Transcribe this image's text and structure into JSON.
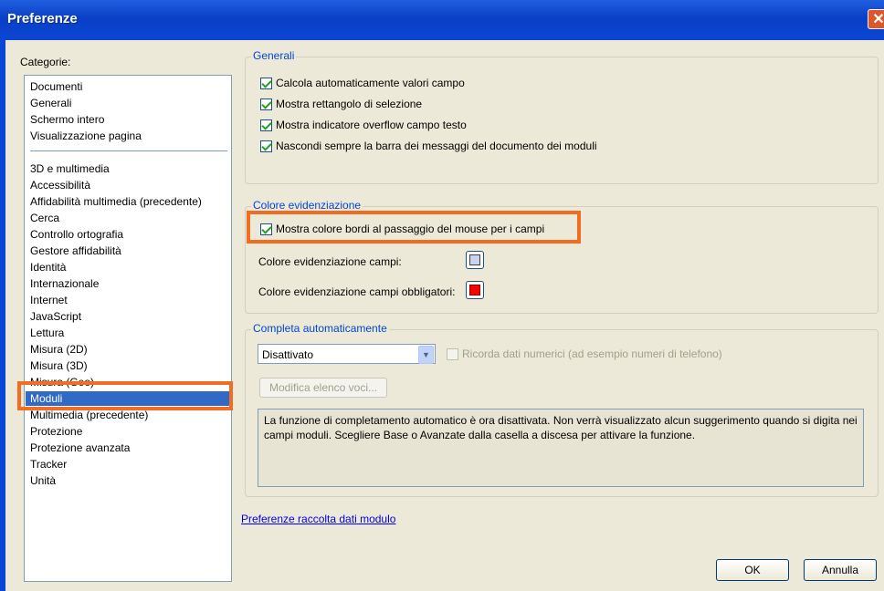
{
  "window": {
    "title": "Preferenze",
    "close_glyph": "✕"
  },
  "categories": {
    "label": "Categorie:",
    "group1": [
      "Documenti",
      "Generali",
      "Schermo intero",
      "Visualizzazione pagina"
    ],
    "group2": [
      "3D e multimedia",
      "Accessibilità",
      "Affidabilità multimedia (precedente)",
      "Cerca",
      "Controllo ortografia",
      "Gestore affidabilità",
      "Identità",
      "Internazionale",
      "Internet",
      "JavaScript",
      "Lettura",
      "Misura (2D)",
      "Misura (3D)",
      "Misura (Geo)",
      "Moduli",
      "Multimedia (precedente)",
      "Protezione",
      "Protezione avanzata",
      "Tracker",
      "Unità"
    ],
    "selected": "Moduli"
  },
  "generali": {
    "title": "Generali",
    "options": [
      {
        "label": "Calcola automaticamente valori campo",
        "checked": true
      },
      {
        "label": "Mostra rettangolo di selezione",
        "checked": true
      },
      {
        "label": "Mostra indicatore overflow campo testo",
        "checked": true
      },
      {
        "label": "Nascondi sempre la barra dei messaggi del documento dei moduli",
        "checked": true
      }
    ]
  },
  "colore": {
    "title": "Colore evidenziazione",
    "hover_label": "Mostra colore bordi al passaggio del mouse per i campi",
    "hover_checked": true,
    "fields_label": "Colore evidenziazione campi:",
    "fields_color": "#c9d4f2",
    "required_label": "Colore evidenziazione campi obbligatori:",
    "required_color": "#ff0000"
  },
  "completa": {
    "title": "Completa automaticamente",
    "select_value": "Disattivato",
    "remember_label": "Ricorda dati numerici (ad esempio numeri di telefono)",
    "edit_button": "Modifica elenco voci...",
    "description": "La funzione di completamento automatico è ora disattivata. Non verrà visualizzato alcun suggerimento quando si digita nei campi moduli. Scegliere Base o Avanzate dalla casella a discesa per attivare la funzione."
  },
  "link": "Preferenze raccolta dati modulo",
  "buttons": {
    "ok": "OK",
    "cancel": "Annulla"
  },
  "highlight_color": "#f26c22"
}
